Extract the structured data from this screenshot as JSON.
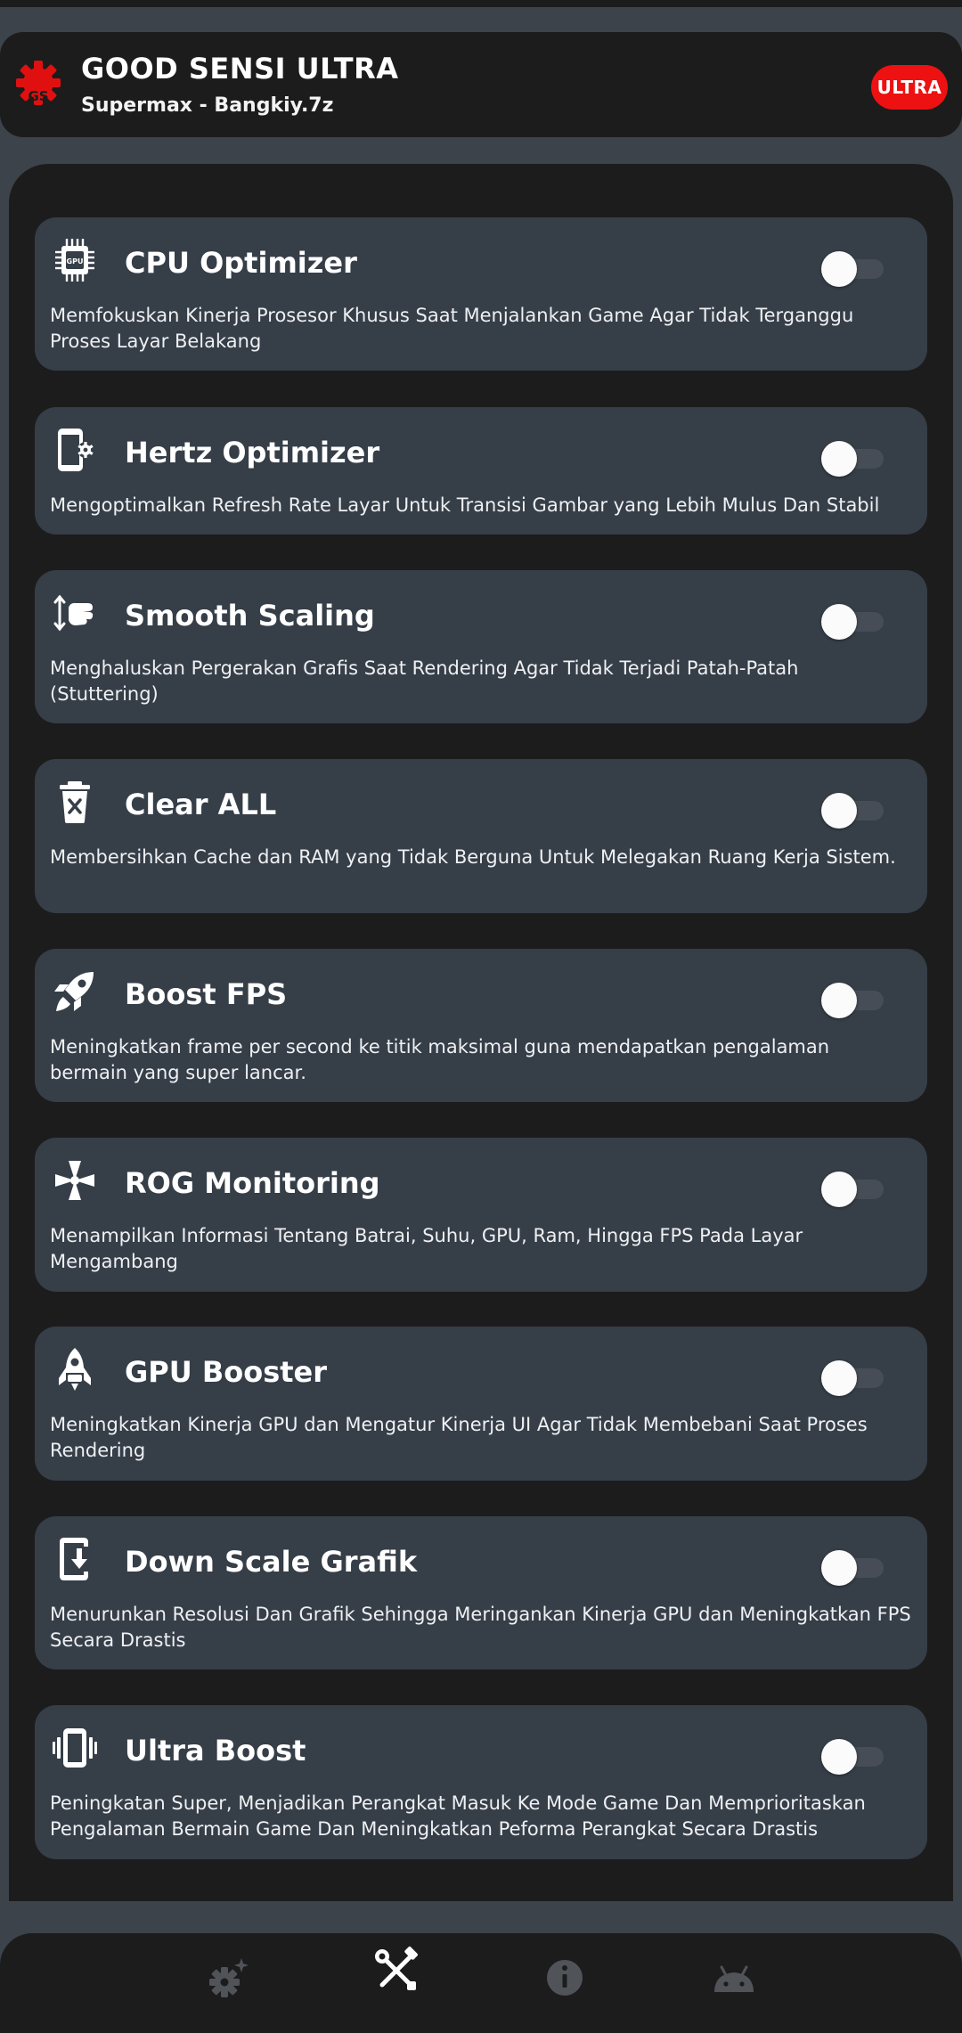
{
  "header": {
    "title": "GOOD SENSI ULTRA",
    "subtitle": "Supermax - Bangkiy.7z",
    "badge": "ULTRA",
    "logo_icon": "red-gear-logo-icon",
    "logo_text": "GS"
  },
  "colors": {
    "background": "#3c434b",
    "panel": "#1c1c1c",
    "card": "#363e48",
    "accent_red": "#ee1111",
    "toggle_track": "#464d57"
  },
  "features": [
    {
      "icon": "cpu-chip-icon",
      "title": "CPU Optimizer",
      "description": "Memfokuskan Kinerja Prosesor Khusus Saat Menjalankan Game Agar Tidak Terganggu Proses Layar Belakang",
      "enabled": false
    },
    {
      "icon": "phone-settings-icon",
      "title": "Hertz Optimizer",
      "description": "Mengoptimalkan Refresh Rate Layar Untuk Transisi Gambar yang Lebih Mulus Dan Stabil",
      "enabled": false
    },
    {
      "icon": "swipe-vertical-icon",
      "title": "Smooth Scaling",
      "description": "Menghaluskan Pergerakan Grafis Saat Rendering Agar Tidak Terjadi Patah-Patah (Stuttering)",
      "enabled": false
    },
    {
      "icon": "trash-clear-icon",
      "title": "Clear ALL",
      "description": "Membersihkan Cache dan RAM yang Tidak Berguna Untuk Melegakan Ruang Kerja Sistem.",
      "enabled": false
    },
    {
      "icon": "rocket-launch-icon",
      "title": "Boost FPS",
      "description": "Meningkatkan frame per second ke titik maksimal guna mendapatkan pengalaman bermain yang super lancar.",
      "enabled": false
    },
    {
      "icon": "fan-icon",
      "title": "ROG Monitoring",
      "description": "Menampilkan Informasi Tentang Batrai, Suhu, GPU, Ram, Hingga FPS Pada Layar Mengambang",
      "enabled": false
    },
    {
      "icon": "rocket-icon",
      "title": "GPU Booster",
      "description": "Meningkatkan Kinerja GPU dan Mengatur Kinerja UI Agar Tidak Membebani Saat Proses Rendering",
      "enabled": false
    },
    {
      "icon": "phone-download-icon",
      "title": "Down Scale Grafik",
      "description": "Menurunkan Resolusi Dan Grafik Sehingga Meringankan Kinerja GPU dan Meningkatkan FPS Secara Drastis",
      "enabled": false
    },
    {
      "icon": "phone-vibrate-icon",
      "title": "Ultra Boost",
      "description": "Peningkatan Super, Menjadikan Perangkat Masuk Ke Mode Game Dan Memprioritaskan Pengalaman Bermain Game Dan Meningkatkan Peforma Perangkat Secara Drastis",
      "enabled": false
    }
  ],
  "bottom_nav": [
    {
      "icon": "gear-sparkle-icon",
      "active": false
    },
    {
      "icon": "tools-icon",
      "active": true
    },
    {
      "icon": "info-icon",
      "active": false
    },
    {
      "icon": "android-icon",
      "active": false
    }
  ]
}
